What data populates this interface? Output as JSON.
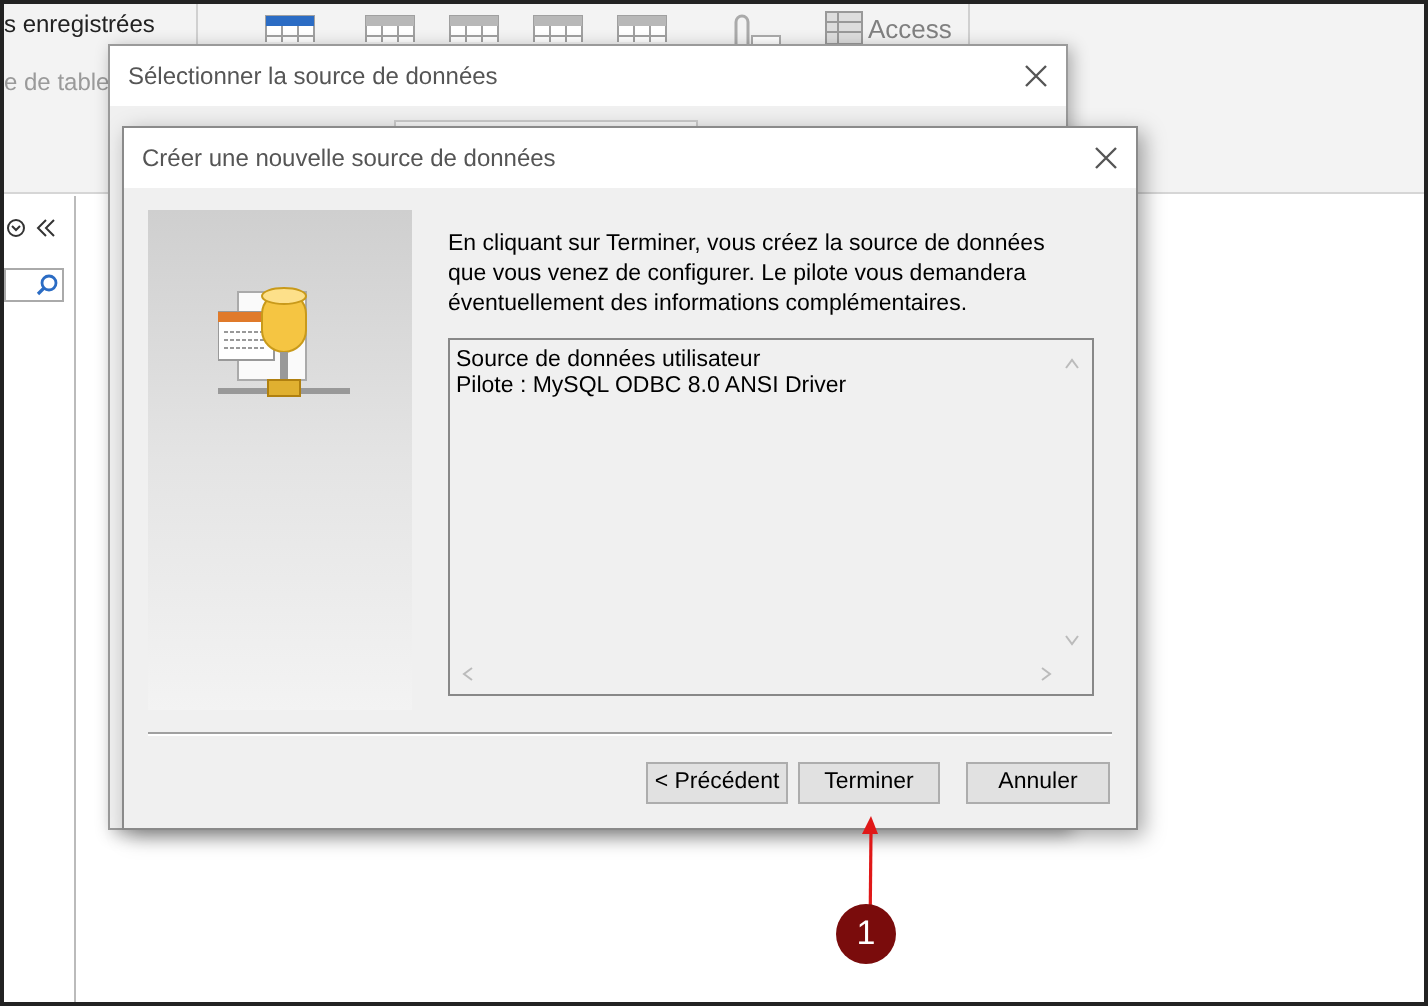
{
  "app": {
    "saved_label": "s enregistrées",
    "table_label": "e de table",
    "ribbon_access_label": "Access"
  },
  "back_dialog": {
    "title": "Sélectionner la source de données"
  },
  "dialog": {
    "title": "Créer une nouvelle source de données",
    "message_lines": [
      "En cliquant sur Terminer, vous créez la source de données",
      "que vous venez de configurer. Le pilote vous demandera",
      "éventuellement des informations complémentaires."
    ],
    "summary_lines": [
      "Source de données utilisateur",
      "Pilote : MySQL ODBC 8.0 ANSI Driver"
    ],
    "buttons": [
      {
        "label": "< Précédent",
        "kind": "back"
      },
      {
        "label": "Terminer",
        "kind": "finish"
      },
      {
        "label": "Annuler",
        "kind": "cancel"
      }
    ]
  },
  "callout": {
    "number": "1"
  }
}
